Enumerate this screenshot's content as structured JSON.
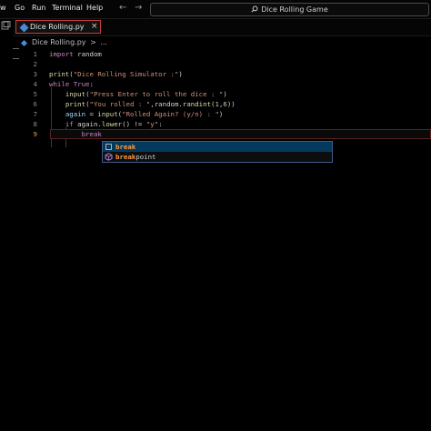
{
  "menu": {
    "items": [
      {
        "label": "w"
      },
      {
        "label": "Go"
      },
      {
        "label": "Run"
      },
      {
        "label": "Terminal"
      },
      {
        "label": "Help"
      }
    ]
  },
  "nav": {
    "back": "←",
    "forward": "→"
  },
  "search": {
    "text": "Dice Rolling Game",
    "icon": "search-icon"
  },
  "tab": {
    "label": "Dice Rolling.py",
    "close": "×",
    "icon": "python-file-icon"
  },
  "breadcrumb": {
    "file": "Dice Rolling.py",
    "separator": ">",
    "rest": "..."
  },
  "editor": {
    "line_numbers": [
      "1",
      "2",
      "3",
      "4",
      "5",
      "6",
      "7",
      "8",
      "9"
    ],
    "current_line": 9
  },
  "suggest": {
    "items": [
      {
        "match": "break",
        "rest": "",
        "icon": "keyword-icon"
      },
      {
        "match": "break",
        "rest": "point",
        "icon": "function-icon"
      }
    ]
  },
  "colors": {
    "accent": "#c83c3c",
    "keyword": "#c586c0",
    "string": "#ce9178",
    "function": "#dcdcaa",
    "match": "#ff9b3e"
  }
}
